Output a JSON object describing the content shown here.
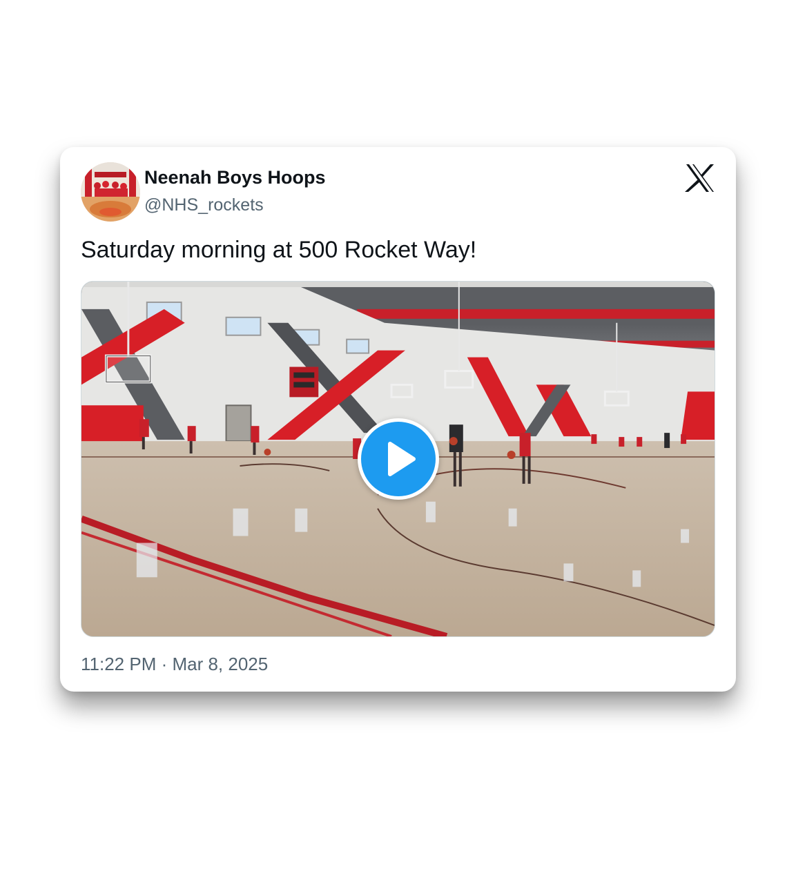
{
  "author": {
    "display_name": "Neenah Boys Hoops",
    "handle": "@NHS_rockets",
    "avatar_icon": "profile-avatar"
  },
  "platform_icon": "x-logo-icon",
  "tweet": {
    "text": "Saturday morning at 500 Rocket Way!",
    "timestamp": "11:22 PM · Mar 8, 2025"
  },
  "media": {
    "type": "video",
    "play_icon": "play-icon"
  },
  "colors": {
    "play_button": "#1d9bf0",
    "text_primary": "#0f1419",
    "text_secondary": "#536471",
    "gym_red": "#d71f27"
  }
}
